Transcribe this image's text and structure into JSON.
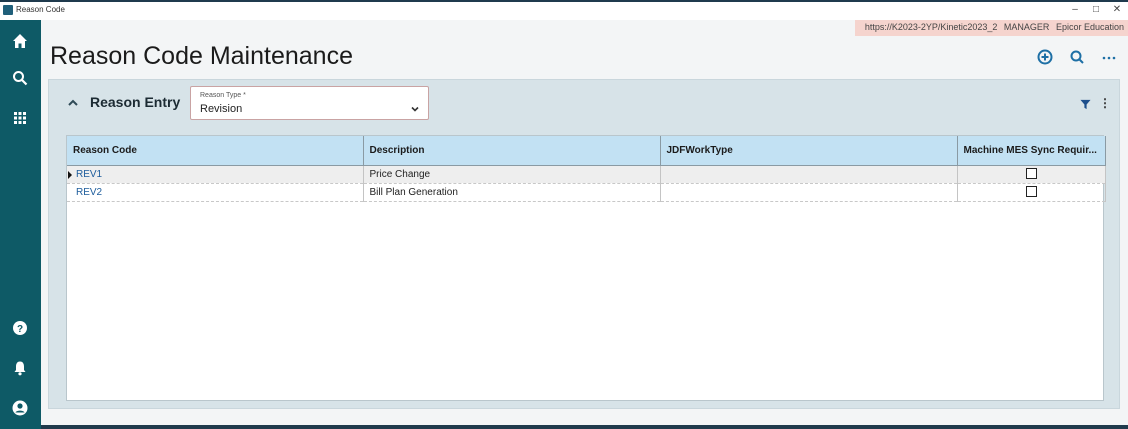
{
  "window": {
    "title": "Reason Code",
    "controls": [
      "–",
      "□",
      "✕"
    ]
  },
  "sidebar": {
    "items": [
      {
        "name": "home-icon"
      },
      {
        "name": "search-icon"
      },
      {
        "name": "apps-grid-icon"
      },
      {
        "name": "help-icon"
      },
      {
        "name": "notifications-icon"
      },
      {
        "name": "account-icon"
      }
    ],
    "color": "#0e5a66"
  },
  "info": {
    "url": "https://K2023-2YP/Kinetic2023_2",
    "user": "MANAGER",
    "company": "Epicor Education"
  },
  "page": {
    "title": "Reason Code Maintenance"
  },
  "toolbar": {
    "icons": [
      "add-icon",
      "search-icon",
      "more-icon"
    ]
  },
  "panel": {
    "title": "Reason Entry",
    "reason_type": {
      "label": "Reason Type *",
      "value": "Revision"
    }
  },
  "grid": {
    "columns": [
      "Reason Code",
      "Description",
      "JDFWorkType",
      "Machine MES Sync Requir..."
    ],
    "rows": [
      {
        "code": "REV1",
        "description": "Price Change",
        "jdf": "",
        "mes_sync": false
      },
      {
        "code": "REV2",
        "description": "Bill Plan Generation",
        "jdf": "",
        "mes_sync": false
      }
    ]
  },
  "colors": {
    "accent": "#1d6fa5",
    "header": "#c2e1f3",
    "info_bg": "#f5d4ce"
  }
}
